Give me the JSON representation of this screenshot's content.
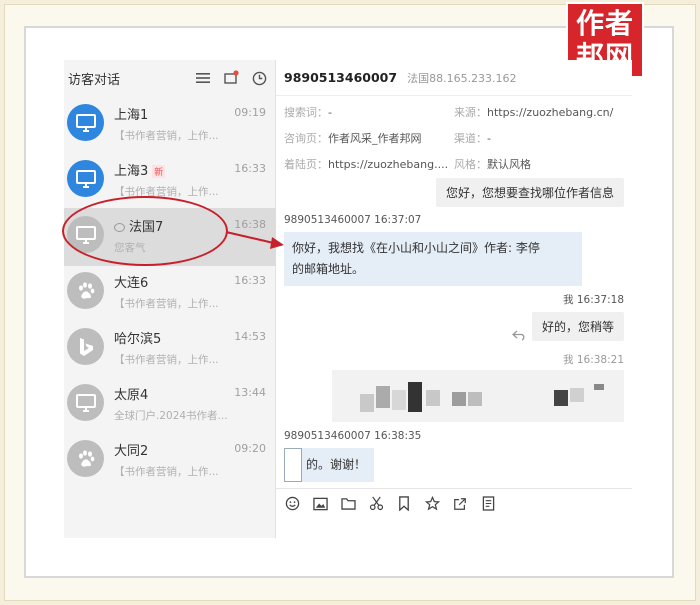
{
  "watermark": {
    "line1": "作者",
    "line2": "邦网"
  },
  "left_panel": {
    "title": "访客对话",
    "icons": [
      "list-icon",
      "sms-icon",
      "clock-icon"
    ]
  },
  "conversations": [
    {
      "name": "上海1",
      "time": "09:19",
      "preview": "【书作者营销，上作...",
      "avatar": "monitor-icon",
      "avatar_color": "#2e86de",
      "active": false,
      "new_badge": ""
    },
    {
      "name": "上海3",
      "time": "16:33",
      "preview": "【书作者营销，上作...",
      "avatar": "monitor-icon",
      "avatar_color": "#2e86de",
      "active": false,
      "new_badge": "新"
    },
    {
      "name": "法国7",
      "time": "16:38",
      "preview": "您客气",
      "avatar": "monitor-icon",
      "avatar_color": "#bdbdbd",
      "active": true,
      "new_badge": ""
    },
    {
      "name": "大连6",
      "time": "16:33",
      "preview": "【书作者营销，上作...",
      "avatar": "paw-icon",
      "avatar_color": "#bdbdbd",
      "active": false,
      "new_badge": ""
    },
    {
      "name": "哈尔滨5",
      "time": "14:53",
      "preview": "【书作者营销，上作...",
      "avatar": "bing-icon",
      "avatar_color": "#bdbdbd",
      "active": false,
      "new_badge": ""
    },
    {
      "name": "太原4",
      "time": "13:44",
      "preview": "全球门户.2024书作者...",
      "avatar": "monitor-icon",
      "avatar_color": "#bdbdbd",
      "active": false,
      "new_badge": ""
    },
    {
      "name": "大同2",
      "time": "09:20",
      "preview": "【书作者营销，上作...",
      "avatar": "paw-icon",
      "avatar_color": "#bdbdbd",
      "active": false,
      "new_badge": ""
    }
  ],
  "chat": {
    "visitor_id": "9890513460007",
    "visitor_location": "法国88.165.233.162",
    "info": {
      "search_k": "搜索词：",
      "search_v": "-",
      "source_k": "来源：",
      "source_v": "https://zuozhebang.cn/",
      "page_k": "咨询页：",
      "page_v": "作者风采_作者邦网",
      "channel_k": "渠道：",
      "channel_v": "-",
      "landing_k": "着陆页：",
      "landing_v": "https://zuozhebang....",
      "style_k": "风格：",
      "style_v": "默认风格"
    },
    "messages": {
      "agent1": "您好，您想要查找哪位作者信息",
      "visitor1_time": "9890513460007 16:37:07",
      "visitor1_line1": "你好，我想找《在小山和小山之间》作者: 李停",
      "visitor1_line2": "的邮箱地址。",
      "agent2_time": "我 16:37:18",
      "agent2": "好的，您稍等",
      "agent3_time": "我 16:38:21",
      "visitor2_time": "9890513460007 16:38:35",
      "visitor2": "的。谢谢！"
    },
    "toolbar": [
      "smile-icon",
      "image-icon",
      "folder-icon",
      "scissors-icon",
      "bookmark-icon",
      "star-icon",
      "share-icon",
      "note-icon"
    ]
  }
}
